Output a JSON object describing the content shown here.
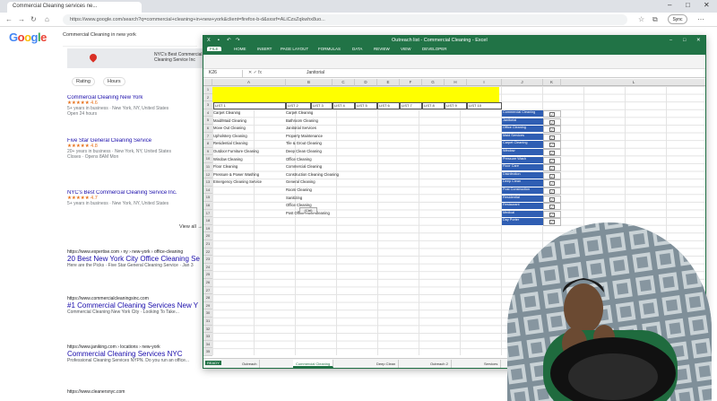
{
  "browser": {
    "tab_title": "Commercial Cleaning services ne...",
    "url": "https://www.google.com/search?q=commercial+cleaning+in+new+york&client=firefox-b-d&sxsrf=ALiCzsZqkwhx8uo...",
    "profile_label": "Sync"
  },
  "google": {
    "logo": "Google",
    "query": "Commercial Cleaning in new york",
    "map_label": "NYC's Best Commercial Cleaning Service Inc",
    "filters": [
      "Rating",
      "Hours"
    ],
    "listings": [
      {
        "title": "Commercial Cleaning New York",
        "rating": "★★★★★ 4.6",
        "line1": "5+ years in business · New York, NY, United States",
        "line2": "Open 24 hours"
      },
      {
        "title": "Five Star General Cleaning Service",
        "rating": "★★★★★ 4.8",
        "line1": "20+ years in business · New York, NY, United States",
        "line2": "Closes · Opens 8AM Mon"
      },
      {
        "title": "NYC's Best Commercial Cleaning Service Inc.",
        "rating": "★★★★★ 4.7",
        "line1": "5+ years in business · New York, NY, United States",
        "line2": ""
      }
    ],
    "view_all": "View all →",
    "results": [
      {
        "url": "https://www.expertise.com › ny › new-york › office-cleaning",
        "title": "20 Best New York City Office Cleaning Se",
        "snippet": "Here are the Picks · Five Star General Cleaning Service · Jan 3"
      },
      {
        "url": "https://www.commercialcleaningsinc.com",
        "title": "#1 Commercial Cleaning Services New Y",
        "snippet": "Commercial Cleaning New York City · Looking To Take..."
      },
      {
        "url": "https://www.janiking.com › locations › new-york",
        "title": "Commercial Cleaning Services NYC",
        "snippet": "Professional Cleaning Services NYPN. Do you run an office..."
      }
    ],
    "bottom_url": "https://www.cleanersnyc.com"
  },
  "excel": {
    "title": "Outreach list - Commercial Cleaning - Excel",
    "ribbon_tabs": [
      "FILE",
      "HOME",
      "INSERT",
      "PAGE LAYOUT",
      "FORMULAS",
      "DATA",
      "REVIEW",
      "VIEW",
      "DEVELOPER"
    ],
    "name_box": "K26",
    "formula_value": "Janitorial",
    "columns": [
      "A",
      "B",
      "C",
      "D",
      "E",
      "F",
      "G",
      "H",
      "I",
      "J",
      "K",
      "L"
    ],
    "header_row": [
      "LIST 1",
      "LIST 2",
      "LIST 3",
      "LIST 4",
      "LIST 5",
      "LIST 6",
      "LIST 7",
      "LIST 8",
      "LIST 9",
      "LIST 10"
    ],
    "col_a": [
      "Carpet Cleaning",
      "Maid/Maid Cleaning",
      "Move Out Cleaning",
      "Upholstery Cleaning",
      "Residential Cleaning",
      "Outdoor Furniture Cleaning",
      "Window Cleaning",
      "Floor Cleaning",
      "Pressure & Power Washing",
      "Emergency Cleaning Service"
    ],
    "col_b": [
      "Carpet Cleaning",
      "Bathroom Cleaning",
      "Janitorial Services",
      "Property Maintenance",
      "Tile & Grout Cleaning",
      "Deep Clean Cleaning",
      "Office Cleaning",
      "Commercial Cleaning",
      "Construction Cleaning Cleaning",
      "General Cleaning",
      "Room Cleaning",
      "Sanitizing",
      "Office Cleaning",
      "Post Office Floor Cleaning"
    ],
    "paste_tag": "(Ctrl)",
    "blue_cells": [
      "Commercial Cleaning",
      "Janitorial",
      "Office Cleaning",
      "Maid Services",
      "Carpet Cleaning",
      "Window",
      "Pressure Wash",
      "Floor Care",
      "Disinfection",
      "Deep Clean",
      "Post Construction",
      "Residential",
      "Restaurant",
      "Medical",
      "Day Porter"
    ],
    "check_mark": "✓",
    "sheet_tabs": [
      "Outreach",
      "Commercial Cleaning",
      "Deep Clean",
      "Outreach 2",
      "Services"
    ],
    "status": "READY"
  }
}
